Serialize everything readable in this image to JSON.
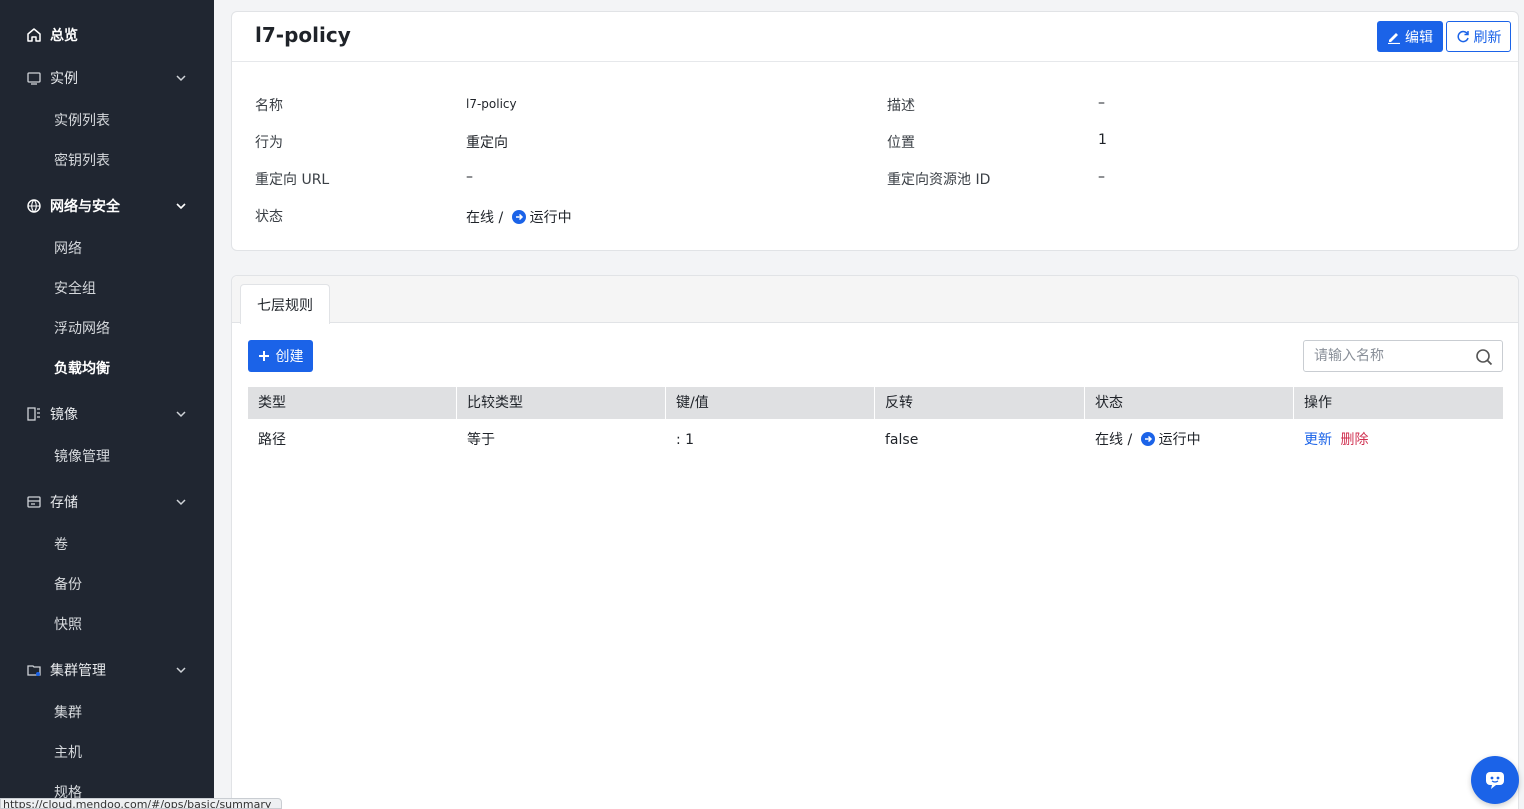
{
  "sidebar": {
    "overview": "总览",
    "instance": {
      "label": "实例",
      "items": [
        "实例列表",
        "密钥列表"
      ]
    },
    "network": {
      "label": "网络与安全",
      "items": [
        "网络",
        "安全组",
        "浮动网络",
        "负载均衡"
      ]
    },
    "image": {
      "label": "镜像",
      "items": [
        "镜像管理"
      ]
    },
    "storage": {
      "label": "存储",
      "items": [
        "卷",
        "备份",
        "快照"
      ]
    },
    "cluster": {
      "label": "集群管理",
      "items": [
        "集群",
        "主机",
        "规格"
      ]
    }
  },
  "detail": {
    "title": "l7-policy",
    "edit_label": "编辑",
    "refresh_label": "刷新",
    "fields": {
      "name_label": "名称",
      "name_value": "l7-policy",
      "desc_label": "描述",
      "desc_value": "–",
      "action_label": "行为",
      "action_value": "重定向",
      "position_label": "位置",
      "position_value": "1",
      "redirect_url_label": "重定向 URL",
      "redirect_url_value": "–",
      "redirect_pool_label": "重定向资源池 ID",
      "redirect_pool_value": "–",
      "status_label": "状态",
      "status_online": "在线",
      "status_sep": "/",
      "status_running": "运行中"
    }
  },
  "rules": {
    "tab_label": "七层规则",
    "create_label": "创建",
    "search_placeholder": "请输入名称",
    "columns": [
      "类型",
      "比较类型",
      "键/值",
      "反转",
      "状态",
      "操作"
    ],
    "rows": [
      {
        "type": "路径",
        "compare": "等于",
        "kv": ": 1",
        "invert": "false",
        "status_online": "在线",
        "status_sep": "/",
        "status_running": "运行中",
        "action_update": "更新",
        "action_delete": "删除"
      }
    ]
  },
  "statusbar_url": "https://cloud.mendoo.com/#/ops/basic/summary",
  "colors": {
    "sidebar_bg": "#202631",
    "primary": "#1b63e8",
    "danger": "#d03050"
  },
  "icons": [
    "home-icon",
    "instance-icon",
    "network-icon",
    "image-icon",
    "storage-icon",
    "cluster-icon",
    "chevron-down-icon",
    "edit-icon",
    "refresh-icon",
    "plus-icon",
    "search-icon",
    "running-icon",
    "chat-icon"
  ]
}
